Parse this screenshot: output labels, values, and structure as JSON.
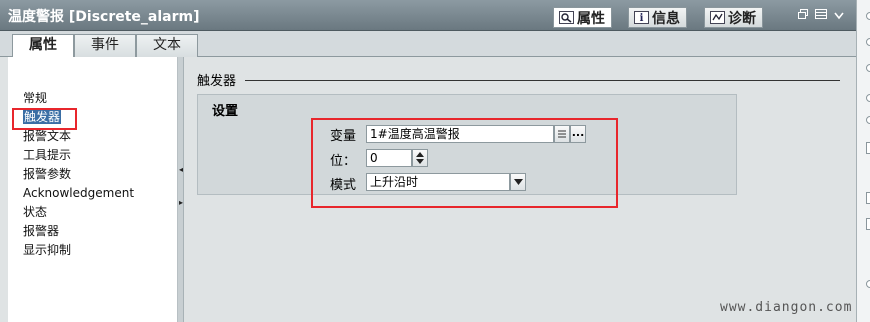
{
  "window": {
    "title": "温度警报 [Discrete_alarm]",
    "panel_tabs": [
      {
        "label": "属性",
        "icon": "properties-icon",
        "active": true
      },
      {
        "label": "信息",
        "icon": "info-icon",
        "active": false
      },
      {
        "label": "诊断",
        "icon": "diagnostics-icon",
        "active": false
      }
    ]
  },
  "tabs": [
    {
      "label": "属性",
      "active": true
    },
    {
      "label": "事件",
      "active": false
    },
    {
      "label": "文本",
      "active": false
    }
  ],
  "nav": {
    "items": [
      {
        "label": "常规",
        "selected": false
      },
      {
        "label": "触发器",
        "selected": true
      },
      {
        "label": "报警文本",
        "selected": false
      },
      {
        "label": "工具提示",
        "selected": false
      },
      {
        "label": "报警参数",
        "selected": false
      },
      {
        "label": "Acknowledgement",
        "selected": false
      },
      {
        "label": "状态",
        "selected": false
      },
      {
        "label": "报警器",
        "selected": false
      },
      {
        "label": "显示抑制",
        "selected": false
      }
    ]
  },
  "section": {
    "title": "触发器",
    "group_title": "设置",
    "fields": {
      "variable": {
        "label": "变量",
        "value": "1#温度高温警报",
        "browse_label": "..."
      },
      "bit": {
        "label": "位：",
        "value": "0"
      },
      "mode": {
        "label": "模式",
        "value": "上升沿时"
      }
    }
  },
  "watermark": "www.diangon.com",
  "colors": {
    "highlight": "#e8262c",
    "selection": "#3a6ea5",
    "titlebar": "#7a8890"
  }
}
